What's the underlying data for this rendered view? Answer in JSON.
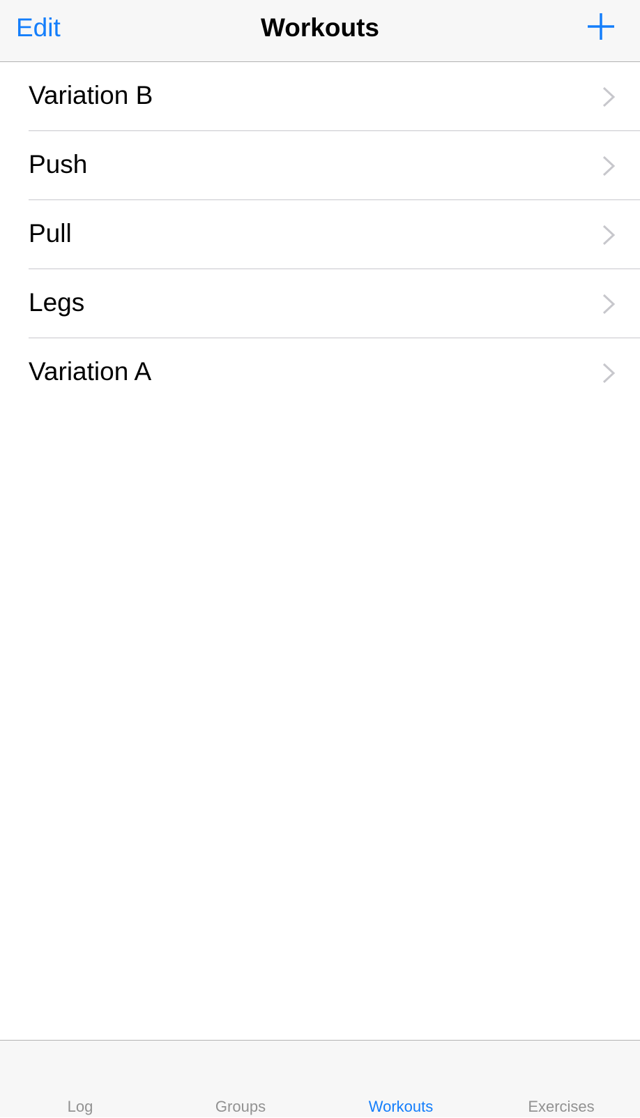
{
  "nav": {
    "edit_label": "Edit",
    "title": "Workouts",
    "add_icon": "plus-icon"
  },
  "workouts": [
    {
      "label": "Variation B"
    },
    {
      "label": "Push"
    },
    {
      "label": "Pull"
    },
    {
      "label": "Legs"
    },
    {
      "label": "Variation A"
    }
  ],
  "tabs": [
    {
      "label": "Log",
      "active": false
    },
    {
      "label": "Groups",
      "active": false
    },
    {
      "label": "Workouts",
      "active": true
    },
    {
      "label": "Exercises",
      "active": false
    }
  ],
  "colors": {
    "accent": "#147efb",
    "inactive_tab": "#929292",
    "chevron": "#c7c7cc",
    "separator": "#c8c7cc",
    "bar_background": "#f7f7f7"
  }
}
